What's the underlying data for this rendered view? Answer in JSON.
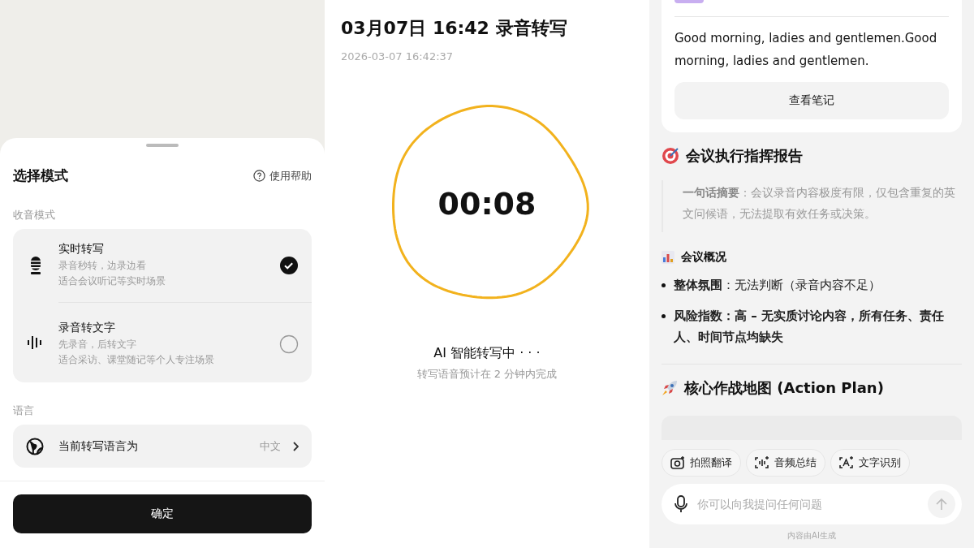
{
  "mode_sheet": {
    "title": "选择模式",
    "help": "使用帮助",
    "section_label": "收音模式",
    "modes": [
      {
        "kind": "mic",
        "title": "实时转写",
        "line1": "录音秒转，边录边看",
        "line2": "适合会议听记等实时场景",
        "selected": true
      },
      {
        "kind": "wave",
        "title": "录音转文字",
        "line1": "先录音，后转文字",
        "line2": "适合采访、课堂随记等个人专注场景",
        "selected": false
      }
    ],
    "language_label": "语言",
    "language_row": {
      "label": "当前转写语言为",
      "value": "中文"
    },
    "confirm": "确定"
  },
  "recording": {
    "title": "03月07日 16:42 录音转写",
    "timestamp": "2026-03-07 16:42:37",
    "timer": "00:08",
    "status": "AI 智能转写中 · · ·",
    "hint": "转写语音预计在 2 分钟内完成"
  },
  "notes": {
    "transcript": "Good morning, ladies and gentlemen.Good morning, ladies and gentlemen.",
    "view_button": "查看笔记",
    "report_title": "会议执行指挥报告",
    "summary": "**一句话摘要**：会议录音内容极度有限，仅包含重复的英文问候语，无法提取有效任务或决策。",
    "overview_title": "会议概况",
    "bullets": [
      "**整体氛围**：无法判断（录音内容不足）",
      "**风险指数：高 – 无实质讨论内容，所有任务、责任人、时间节点均缺失**"
    ],
    "plan_title": "核心作战地图 (Action Plan)",
    "chips": [
      {
        "kind": "camera",
        "label": "拍照翻译"
      },
      {
        "kind": "audio",
        "label": "音频总结"
      },
      {
        "kind": "text",
        "label": "文字识别"
      }
    ],
    "ask": {
      "placeholder": "你可以向我提问任何问题"
    },
    "footer": "内容由AI生成"
  }
}
